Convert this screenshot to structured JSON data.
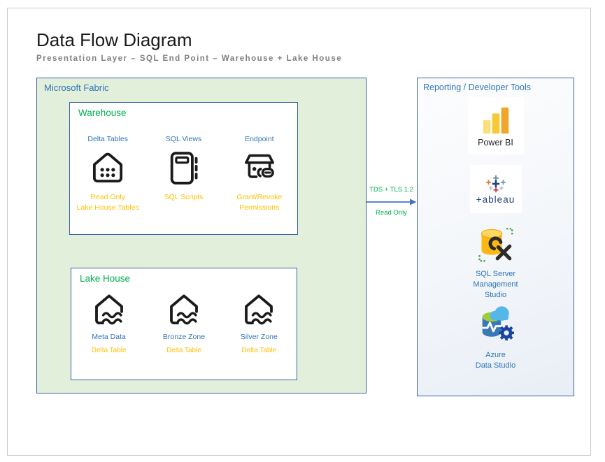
{
  "page": {
    "title": "Data Flow Diagram",
    "subtitle": "Presentation Layer – SQL End Point – Warehouse + Lake House"
  },
  "fabric": {
    "label": "Microsoft Fabric",
    "warehouse": {
      "label": "Warehouse",
      "items": [
        {
          "title": "Delta Tables",
          "icon": "warehouse-house-icon",
          "note": "Read Only\nLake House Tables"
        },
        {
          "title": "SQL Views",
          "icon": "notebook-icon",
          "note": "SQL Scripts"
        },
        {
          "title": "Endpoint",
          "icon": "box-link-icon",
          "note": "Grant/Revoke\nPermissions"
        }
      ]
    },
    "lakehouse": {
      "label": "Lake House",
      "items": [
        {
          "title": "Meta Data",
          "icon": "lake-house-icon",
          "note": "Delta Table"
        },
        {
          "title": "Bronze Zone",
          "icon": "lake-house-icon",
          "note": "Delta Table"
        },
        {
          "title": "Silver Zone",
          "icon": "lake-house-icon",
          "note": "Delta Table"
        }
      ]
    }
  },
  "connector": {
    "top_label": "TDS + TLS 1.2",
    "bottom_label": "Read Only"
  },
  "reporting": {
    "label": "Reporting / Developer Tools",
    "tools": [
      {
        "name": "Power BI",
        "icon": "power-bi-icon"
      },
      {
        "name": "+ableau",
        "icon": "tableau-icon"
      },
      {
        "name": "SQL Server\nManagement\nStudio",
        "icon": "ssms-icon"
      },
      {
        "name": "Azure\nData Studio",
        "icon": "azure-data-studio-icon"
      }
    ]
  },
  "colors": {
    "accent_blue": "#2e75b6",
    "border_blue": "#3a62a8",
    "arrow_blue": "#4472c4",
    "green": "#00b050",
    "orange": "#ffc000",
    "fabric_fill": "#e2efda"
  }
}
